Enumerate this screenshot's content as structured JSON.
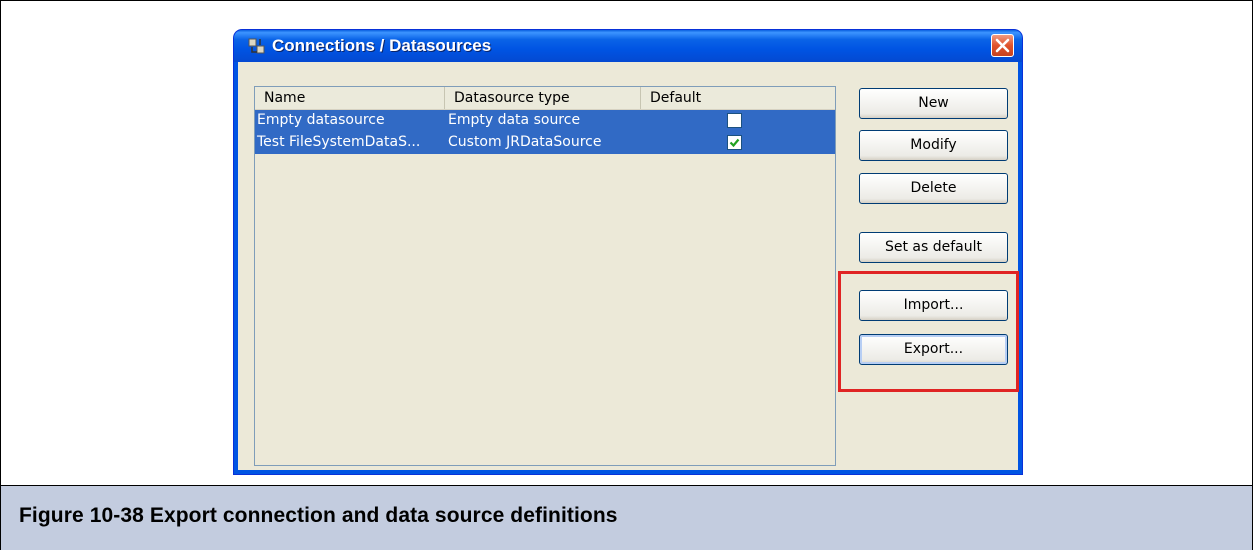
{
  "window": {
    "title": "Connections / Datasources",
    "close_symbol": "✕"
  },
  "table": {
    "columns": [
      "Name",
      "Datasource type",
      "Default"
    ],
    "rows": [
      {
        "name": "Empty datasource",
        "type": "Empty data source",
        "default": false
      },
      {
        "name": "Test FileSystemDataS...",
        "type": "Custom JRDataSource",
        "default": true
      }
    ]
  },
  "buttons": {
    "new": "New",
    "modify": "Modify",
    "delete": "Delete",
    "set_default": "Set as default",
    "import": "Import...",
    "export": "Export..."
  },
  "caption": "Figure 10-38  Export connection and data source definitions",
  "colors": {
    "titlebar": "#0054e3",
    "selection": "#316ac5",
    "highlight": "#e02424",
    "caption_bg": "#c3ccdf"
  },
  "icons": {
    "app": "connections-app-icon",
    "close": "close-icon",
    "check": "checkmark-icon"
  }
}
